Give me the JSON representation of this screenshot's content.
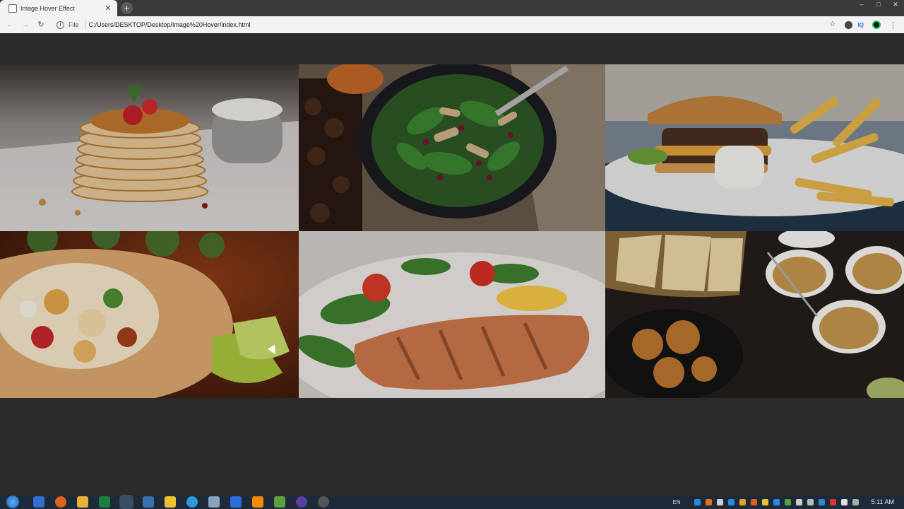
{
  "browser": {
    "tab_title": "Image Hover Effect",
    "file_label": "File",
    "url": "C:/Users/DESKTOP/Desktop/Image%20Hover/index.html"
  },
  "gallery": {
    "images": [
      {
        "name": "pancakes",
        "colors": [
          "#d8d4cf",
          "#c58a45",
          "#8a1d1d"
        ]
      },
      {
        "name": "spinach-salad",
        "colors": [
          "#5a4a3a",
          "#2f5e2a",
          "#7a1432"
        ]
      },
      {
        "name": "burger-fries",
        "colors": [
          "#35495e",
          "#a8672d",
          "#e7b54a"
        ]
      },
      {
        "name": "burrito",
        "colors": [
          "#6a2b12",
          "#d8a26a",
          "#a8c23b"
        ]
      },
      {
        "name": "grilled-salmon",
        "colors": [
          "#d6d2cd",
          "#c9754a",
          "#2e6b2c"
        ]
      },
      {
        "name": "indian-dishes",
        "colors": [
          "#2a2420",
          "#c2934d",
          "#b8742d"
        ]
      }
    ]
  },
  "taskbar": {
    "lang": "EN",
    "clock": "5:11 AM"
  }
}
